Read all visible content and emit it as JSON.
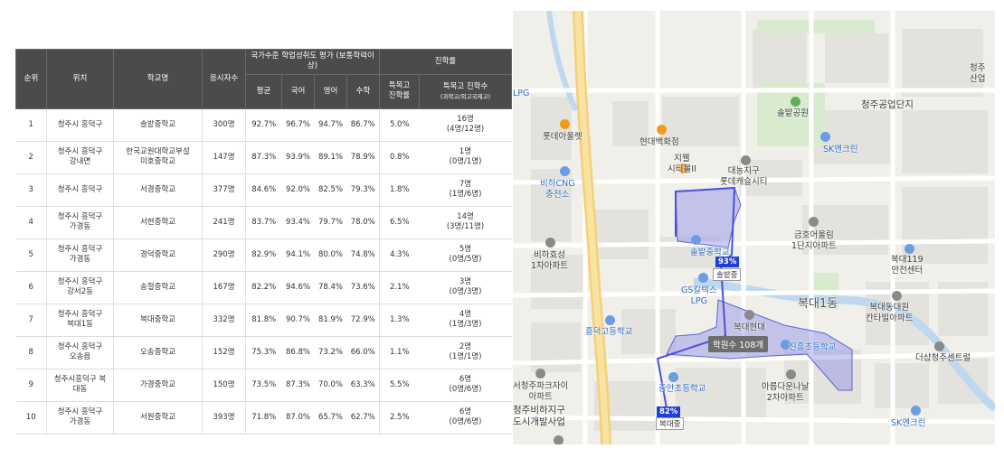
{
  "table": {
    "headers": {
      "rank": "순위",
      "location": "위치",
      "school": "학교명",
      "examinees": "응시자수",
      "assessment_group": "국가수준 학업성취도 평가 (보통학력이상)",
      "avg": "평균",
      "korean": "국어",
      "english": "영어",
      "math": "수학",
      "advance_group": "진학률",
      "special_rate_line1": "특목고",
      "special_rate_line2": "진학률",
      "special_count_line1": "특목고 진학수",
      "special_count_line2": "(과학고/외고국제고)"
    },
    "rows": [
      {
        "rank": "1",
        "loc": [
          "청주시 흥덕구"
        ],
        "school": [
          "솔밭중학교"
        ],
        "n": "300명",
        "avg": "92.7%",
        "kor": "96.7%",
        "eng": "94.7%",
        "math": "86.7%",
        "rate": "5.0%",
        "cnt": [
          "16명",
          "(4명/12명)"
        ]
      },
      {
        "rank": "2",
        "loc": [
          "청주시 흥덕구",
          "강내면"
        ],
        "school": [
          "한국교원대학교부설",
          "미호중학교"
        ],
        "n": "147명",
        "avg": "87.3%",
        "kor": "93.9%",
        "eng": "89.1%",
        "math": "78.9%",
        "rate": "0.8%",
        "cnt": [
          "1명",
          "(0명/1명)"
        ]
      },
      {
        "rank": "3",
        "loc": [
          "청주시 흥덕구"
        ],
        "school": [
          "서경중학교"
        ],
        "n": "377명",
        "avg": "84.6%",
        "kor": "92.0%",
        "eng": "82.5%",
        "math": "79.3%",
        "rate": "1.8%",
        "cnt": [
          "7명",
          "(1명/6명)"
        ]
      },
      {
        "rank": "4",
        "loc": [
          "청주시 흥덕구",
          "가경동"
        ],
        "school": [
          "서현중학교"
        ],
        "n": "241명",
        "avg": "83.7%",
        "kor": "93.4%",
        "eng": "79.7%",
        "math": "78.0%",
        "rate": "6.5%",
        "cnt": [
          "14명",
          "(3명/11명)"
        ]
      },
      {
        "rank": "5",
        "loc": [
          "청주시 흥덕구",
          "가경동"
        ],
        "school": [
          "경덕중학교"
        ],
        "n": "290명",
        "avg": "82.9%",
        "kor": "94.1%",
        "eng": "80.0%",
        "math": "74.8%",
        "rate": "4.3%",
        "cnt": [
          "5명",
          "(0명/5명)"
        ]
      },
      {
        "rank": "6",
        "loc": [
          "청주시 흥덕구",
          "강서2동"
        ],
        "school": [
          "송절중학교"
        ],
        "n": "167명",
        "avg": "82.2%",
        "kor": "94.6%",
        "eng": "78.4%",
        "math": "73.6%",
        "rate": "2.1%",
        "cnt": [
          "3명",
          "(0명/3명)"
        ]
      },
      {
        "rank": "7",
        "loc": [
          "청주시 흥덕구",
          "복대1동"
        ],
        "school": [
          "복대중학교"
        ],
        "n": "332명",
        "avg": "81.8%",
        "kor": "90.7%",
        "eng": "81.9%",
        "math": "72.9%",
        "rate": "1.3%",
        "cnt": [
          "4명",
          "(1명/3명)"
        ]
      },
      {
        "rank": "8",
        "loc": [
          "청주시 흥덕구",
          "오송읍"
        ],
        "school": [
          "오송중학교"
        ],
        "n": "152명",
        "avg": "75.3%",
        "kor": "86.8%",
        "eng": "73.2%",
        "math": "66.0%",
        "rate": "1.1%",
        "cnt": [
          "2명",
          "(1명/1명)"
        ]
      },
      {
        "rank": "9",
        "loc": [
          "청주시흥덕구 복",
          "대동"
        ],
        "school": [
          "가경중학교"
        ],
        "n": "150명",
        "avg": "73.5%",
        "kor": "87.3%",
        "eng": "70.0%",
        "math": "63.3%",
        "rate": "5.5%",
        "cnt": [
          "6명",
          "(0명/6명)"
        ]
      },
      {
        "rank": "10",
        "loc": [
          "청주시 흥덕구",
          "가경동"
        ],
        "school": [
          "서원중학교"
        ],
        "n": "393명",
        "avg": "71.8%",
        "kor": "87.0%",
        "eng": "65.7%",
        "math": "62.7%",
        "rate": "2.5%",
        "cnt": [
          "6명",
          "(0명/6명)"
        ]
      }
    ]
  },
  "map": {
    "labels": {
      "lpg_left": "LPG",
      "top_right": "청주\n산업",
      "solbat_park": "솔밭공원",
      "cheongju_industrial": "청주공업단지",
      "lotte_outlet": "롯데아울렛",
      "hyundai_dept": "현대백화점",
      "sk_energy_1": "SK엔크린",
      "daenong": "대농지구\n롯데캐슬시티",
      "jiwell": "지웰\n시티몰II",
      "bihacng": "비하CNG\n충전소",
      "geumho": "금호어울림\n1단지아파트",
      "bokdae119": "복대119\n안전센터",
      "biha_hyosung": "비하효성\n1차아파트",
      "solbat_school": "솔밭중학교",
      "solbat_tag": "솔밭중",
      "gs_lpg": "GS칼텍스\nLPG",
      "bokdae1": "복대1동",
      "bokdae_hyundai": "복대현대",
      "bokdae_apt": "복대동대원\n칸타빌아파트",
      "heungdeok_hs": "흥덕고등학교",
      "academy_count": "학원수 108개",
      "jinheung_es": "진흥초등학교",
      "deosap": "더샵청주센트럴",
      "jeungan_es": "증안초등학교",
      "seocheongju": "서청주파크자이\n아파트",
      "areum": "아름다운나날\n2차아파트",
      "cheongju_biha": "청주비하지구\n도시개발사업",
      "bokdae_tag": "복대중",
      "sk_energy_2": "SK엔크린"
    },
    "badges": {
      "solbat_pct": "93%",
      "bokdae_pct": "82%"
    },
    "colors": {
      "zone_fill": "#8b8fe8",
      "badge": "#1f3fd6",
      "header_bg": "#4b4b4b"
    }
  }
}
